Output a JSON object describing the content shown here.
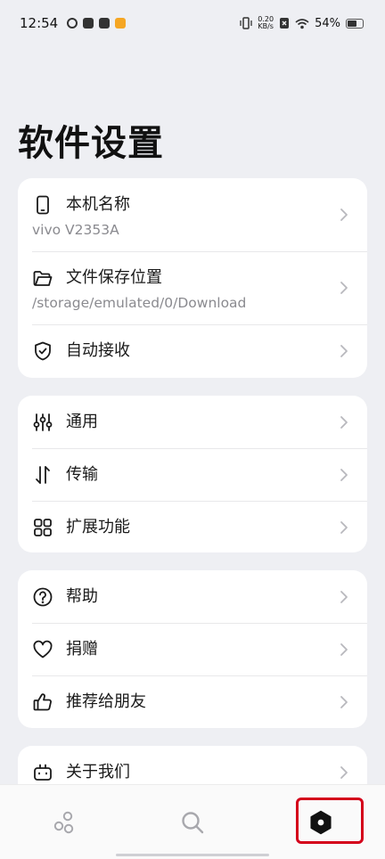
{
  "status_bar": {
    "time": "12:54",
    "net_speed_value": "0.20",
    "net_speed_unit": "KB/s",
    "battery": "54%"
  },
  "page": {
    "title": "软件设置"
  },
  "groups": {
    "device": {
      "name": {
        "label": "本机名称",
        "value": "vivo V2353A",
        "icon": "phone-icon"
      },
      "save_location": {
        "label": "文件保存位置",
        "value": "/storage/emulated/0/Download",
        "icon": "folder-icon"
      },
      "auto_receive": {
        "label": "自动接收",
        "icon": "shield-check-icon"
      }
    },
    "general": {
      "general": {
        "label": "通用",
        "icon": "sliders-icon"
      },
      "transfer": {
        "label": "传输",
        "icon": "transfer-arrows-icon"
      },
      "extensions": {
        "label": "扩展功能",
        "icon": "grid-icon"
      }
    },
    "support": {
      "help": {
        "label": "帮助",
        "icon": "help-icon"
      },
      "donate": {
        "label": "捐赠",
        "icon": "heart-icon"
      },
      "recommend": {
        "label": "推荐给朋友",
        "icon": "thumbs-up-icon"
      }
    },
    "about": {
      "about_us": {
        "label": "关于我们",
        "icon": "robot-icon"
      }
    }
  },
  "bottom_nav": {
    "items": [
      "receive-icon",
      "search-icon",
      "settings-hexagon-icon"
    ],
    "active": "settings"
  },
  "colors": {
    "background": "#eeeff3",
    "card": "#ffffff",
    "highlight_frame": "#d4001a",
    "secondary_text": "#8a8a8f"
  }
}
